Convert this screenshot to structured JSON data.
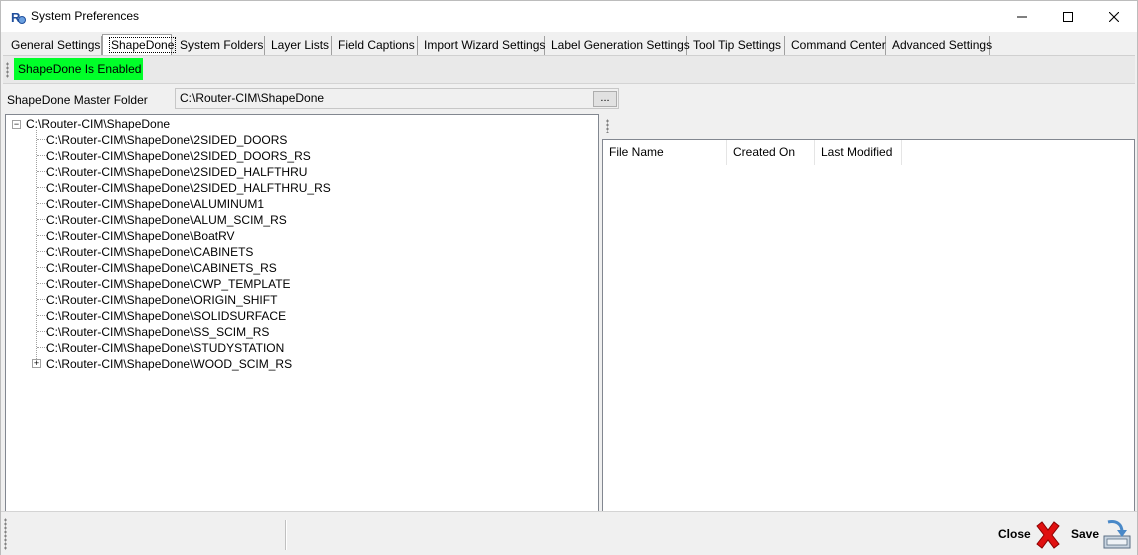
{
  "window": {
    "title": "System Preferences"
  },
  "tabs": [
    {
      "label": "General Settings",
      "active": false
    },
    {
      "label": "ShapeDone",
      "active": true
    },
    {
      "label": "System Folders",
      "active": false
    },
    {
      "label": "Layer Lists",
      "active": false
    },
    {
      "label": "Field Captions",
      "active": false
    },
    {
      "label": "Import Wizard Settings",
      "active": false
    },
    {
      "label": "Label Generation Settings",
      "active": false
    },
    {
      "label": "Tool Tip Settings",
      "active": false
    },
    {
      "label": "Command Center",
      "active": false
    },
    {
      "label": "Advanced Settings",
      "active": false
    }
  ],
  "shapedone": {
    "status": "ShapeDone Is Enabled",
    "status_color": "#00ff29",
    "master_folder_label": "ShapeDone Master Folder",
    "master_folder_value": "C:\\Router-CIM\\ShapeDone",
    "browse_label": "..."
  },
  "tree": {
    "root": "C:\\Router-CIM\\ShapeDone",
    "children": [
      {
        "label": "C:\\Router-CIM\\ShapeDone\\2SIDED_DOORS",
        "expandable": false
      },
      {
        "label": "C:\\Router-CIM\\ShapeDone\\2SIDED_DOORS_RS",
        "expandable": false
      },
      {
        "label": "C:\\Router-CIM\\ShapeDone\\2SIDED_HALFTHRU",
        "expandable": false
      },
      {
        "label": "C:\\Router-CIM\\ShapeDone\\2SIDED_HALFTHRU_RS",
        "expandable": false
      },
      {
        "label": "C:\\Router-CIM\\ShapeDone\\ALUMINUM1",
        "expandable": false
      },
      {
        "label": "C:\\Router-CIM\\ShapeDone\\ALUM_SCIM_RS",
        "expandable": false
      },
      {
        "label": "C:\\Router-CIM\\ShapeDone\\BoatRV",
        "expandable": false
      },
      {
        "label": "C:\\Router-CIM\\ShapeDone\\CABINETS",
        "expandable": false
      },
      {
        "label": "C:\\Router-CIM\\ShapeDone\\CABINETS_RS",
        "expandable": false
      },
      {
        "label": "C:\\Router-CIM\\ShapeDone\\CWP_TEMPLATE",
        "expandable": false
      },
      {
        "label": "C:\\Router-CIM\\ShapeDone\\ORIGIN_SHIFT",
        "expandable": false
      },
      {
        "label": "C:\\Router-CIM\\ShapeDone\\SOLIDSURFACE",
        "expandable": false
      },
      {
        "label": "C:\\Router-CIM\\ShapeDone\\SS_SCIM_RS",
        "expandable": false
      },
      {
        "label": "C:\\Router-CIM\\ShapeDone\\STUDYSTATION",
        "expandable": false
      },
      {
        "label": "C:\\Router-CIM\\ShapeDone\\WOOD_SCIM_RS",
        "expandable": true
      }
    ]
  },
  "filelist": {
    "columns": [
      "File Name",
      "Created On",
      "Last Modified"
    ],
    "rows": []
  },
  "footer": {
    "close_label": "Close",
    "save_label": "Save"
  },
  "icons": {
    "app": "router-cim-logo-icon",
    "close": "red-x-icon",
    "save": "save-disk-icon"
  }
}
